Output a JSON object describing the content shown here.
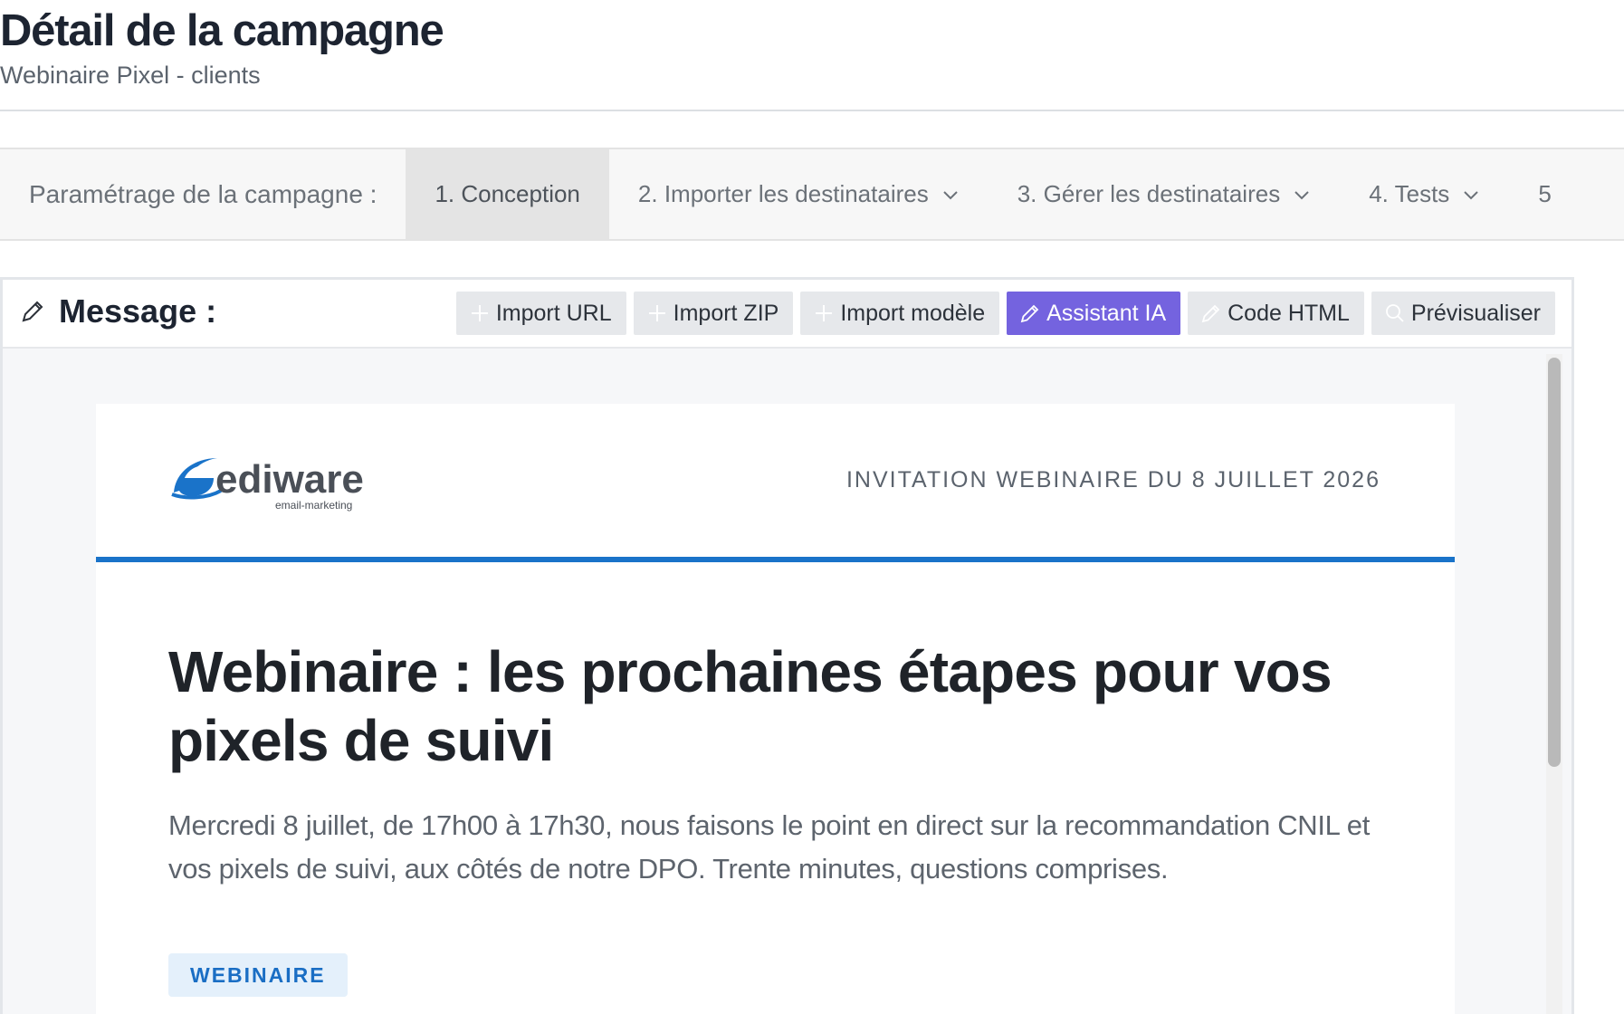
{
  "page": {
    "title": "Détail de la campagne",
    "subtitle": "Webinaire Pixel - clients"
  },
  "steps": {
    "label": "Paramétrage de la campagne :",
    "items": [
      {
        "label": "1. Conception",
        "active": true
      },
      {
        "label": "2. Importer les destinataires",
        "icon": "chevron-down-icon"
      },
      {
        "label": "3. Gérer les destinataires",
        "icon": "chevron-down-icon"
      },
      {
        "label": "4. Tests",
        "icon": "chevron-down-icon"
      },
      {
        "label": "5"
      }
    ]
  },
  "editor": {
    "title": "Message :",
    "title_icon": "pencil-icon",
    "toolbar": {
      "import_url": "Import URL",
      "import_zip": "Import ZIP",
      "import_template": "Import modèle",
      "ai_assistant": "Assistant IA",
      "html_code": "Code HTML",
      "preview": "Prévisualiser"
    },
    "colors": {
      "ai_button": "#7463df",
      "accent_line": "#1a73c9"
    }
  },
  "email": {
    "logo_name": "ediware",
    "logo_tagline": "email-marketing",
    "header_text": "INVITATION WEBINAIRE DU 8 JUILLET 2026",
    "title": "Webinaire : les prochaines étapes pour vos pixels de suivi",
    "intro": "Mercredi 8 juillet, de 17h00 à 17h30, nous faisons le point en direct sur la recommandation CNIL et vos pixels de suivi, aux côtés de notre DPO. Trente minutes, questions comprises.",
    "badge": "WEBINAIRE"
  }
}
